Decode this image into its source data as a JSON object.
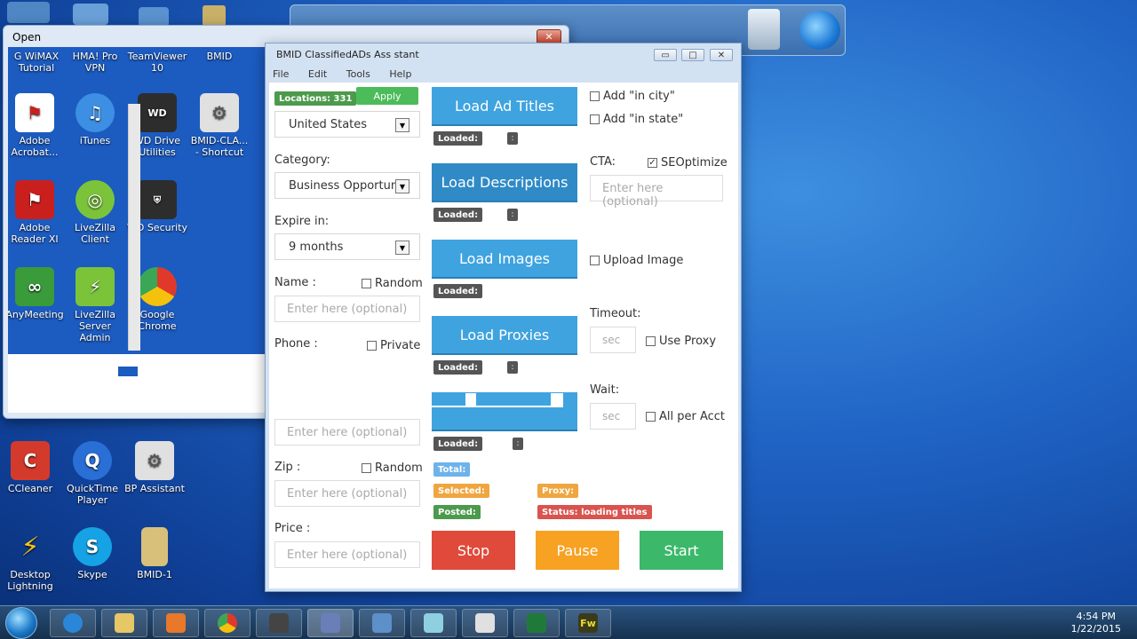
{
  "desktop": {
    "icons_left_top": [
      {
        "label": "G WiMAX Tutorial"
      },
      {
        "label": "HMA! Pro VPN"
      },
      {
        "label": "TeamViewer 10"
      },
      {
        "label": "BMID"
      }
    ],
    "icons_bottom": [
      {
        "label": "CCleaner",
        "color": "#d33a2c"
      },
      {
        "label": "QuickTime Player",
        "color": "#2a6fd6"
      },
      {
        "label": "BP Assistant",
        "color": "#6b6b6b"
      },
      {
        "label": "Desktop Lightning",
        "color": "#f2c21c"
      },
      {
        "label": "Skype",
        "color": "#15a3e6"
      },
      {
        "label": "BMID-1",
        "color": "#d9c07a"
      }
    ]
  },
  "open_window": {
    "title": "Open",
    "close_glyph": "✕",
    "icons": [
      {
        "label": "Adobe Acrobat...",
        "color": "#c9201e"
      },
      {
        "label": "iTunes",
        "color": "#3d8fe3"
      },
      {
        "label": "WD Drive Utilities",
        "color": "#2d2d2d"
      },
      {
        "label": "BMID-CLA... - Shortcut",
        "color": "#777777"
      },
      {
        "label": "Adobe Reader XI",
        "color": "#c9201e"
      },
      {
        "label": "LiveZilla Client",
        "color": "#7bc43a"
      },
      {
        "label": "WD Security",
        "color": "#2d2d2d"
      },
      {
        "label": "AnyMeeting",
        "color": "#3a9b3a"
      },
      {
        "label": "LiveZilla Server Admin",
        "color": "#7bc43a"
      },
      {
        "label": "Google Chrome",
        "color": "#e0392b"
      }
    ]
  },
  "main_window": {
    "title": "BMID ClassifiedADs Ass stant",
    "win_buttons": {
      "minimize": "▭",
      "maximize": "□",
      "close": "✕"
    },
    "menu": [
      "File",
      "Edit",
      "Tools",
      "Help"
    ],
    "locations_badge": "Locations: 331",
    "apply_label": "Apply",
    "country": "United States",
    "category_label": "Category:",
    "category_value": "Business Opportuni",
    "expire_label": "Expire in:",
    "expire_value": "9 months",
    "name_label": "Name :",
    "random_label": "Random",
    "phone_label": "Phone :",
    "private_label": "Private",
    "zip_label": "Zip :",
    "price_label": "Price :",
    "placeholder": "Enter here (optional)",
    "arrow_glyph": "▼",
    "load_ad_titles": "Load Ad Titles",
    "load_descriptions": "Load Descriptions",
    "load_images": "Load Images",
    "load_proxies": "Load Proxies",
    "loaded_label": "Loaded:",
    "dot_glyph": ":",
    "add_in_city": "Add \"in city\"",
    "add_in_state": "Add \"in state\"",
    "cta_label": "CTA:",
    "seoptimize_label": "SEOptimize",
    "check_glyph": "✓",
    "upload_image": "Upload Image",
    "timeout_label": "Timeout:",
    "sec_placeholder": "sec",
    "use_proxy": "Use Proxy",
    "wait_label": "Wait:",
    "all_per_acct": "All per Acct",
    "total_badge": "Total:",
    "selected_badge": "Selected:",
    "proxy_badge": "Proxy:",
    "posted_badge": "Posted:",
    "status_badge": "Status: loading titles",
    "stop_label": "Stop",
    "pause_label": "Pause",
    "start_label": "Start"
  },
  "taskbar": {
    "time": "4:54 PM",
    "date": "1/22/2015",
    "fw_label": "Fw"
  },
  "colors": {
    "blue_button": "#3fa3df",
    "stop": "#e04a3a",
    "pause": "#f7a223",
    "start": "#3cb86a",
    "badge_green": "#4c9a4c",
    "badge_orange": "#f0a640",
    "badge_blue": "#6db3ea",
    "badge_red": "#d9534f"
  }
}
